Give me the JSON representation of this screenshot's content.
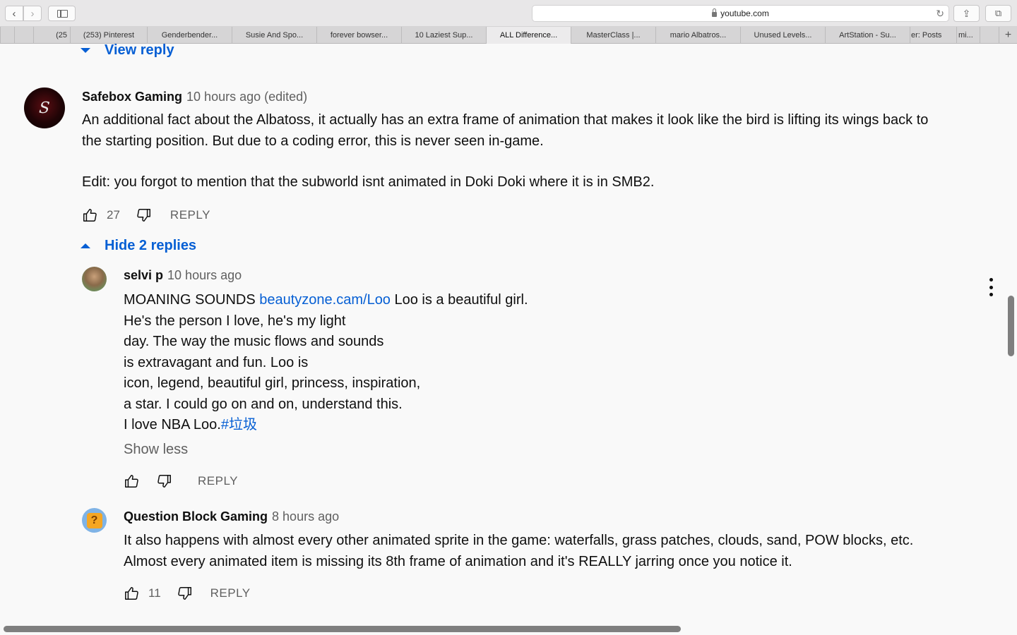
{
  "browser": {
    "address": "youtube.com",
    "tabs": [
      {
        "label": "(25"
      },
      {
        "label": "(253) Pinterest"
      },
      {
        "label": "Genderbender..."
      },
      {
        "label": "Susie And Spo..."
      },
      {
        "label": "forever bowser..."
      },
      {
        "label": "10 Laziest Sup..."
      },
      {
        "label": "ALL Difference..."
      },
      {
        "label": "MasterClass |..."
      },
      {
        "label": "mario Albatros..."
      },
      {
        "label": "Unused Levels..."
      },
      {
        "label": "ArtStation - Su..."
      },
      {
        "label": "er: Posts"
      },
      {
        "label": "mi..."
      }
    ],
    "new_tab": "+"
  },
  "view_reply": "View reply",
  "comment": {
    "author": "Safebox Gaming",
    "time": "10 hours ago (edited)",
    "avatar_letter": "S",
    "line1": "An additional fact about the Albatoss, it actually has an extra frame of animation that makes it look like the bird is lifting its wings back to",
    "line2": "the starting position. But due to a coding error, this is never seen in-game.",
    "line3": "Edit: you forgot to mention that the subworld isnt animated in Doki Doki where it is in SMB2.",
    "likes": "27",
    "reply": "REPLY"
  },
  "hide_replies": "Hide 2 replies",
  "reply1": {
    "author": "selvi p",
    "time": "10 hours ago",
    "line1_a": "MOANING SOUNDS ",
    "line1_link": "beautyzone.cam/Loo",
    "line1_b": " Loo is a beautiful girl.",
    "line2": "He's the person I love, he's my light",
    "line3": "day. The way the music flows and sounds",
    "line4": "is extravagant and fun. Loo is",
    "line5": "icon, legend, beautiful girl, princess, inspiration,",
    "line6": "a star. I could go on and on, understand this.",
    "line7_a": "I love NBA Loo.",
    "line7_tag": "#垃圾",
    "show_less": "Show less",
    "reply": "REPLY"
  },
  "reply2": {
    "author": "Question Block Gaming",
    "time": "8 hours ago",
    "avatar_glyph": "?",
    "line1": "It also happens with almost every other animated sprite in the game: waterfalls, grass patches, clouds, sand, POW blocks, etc.",
    "line2": "Almost every animated item is missing its 8th frame of animation and it's REALLY jarring once you notice it.",
    "likes": "11",
    "reply": "REPLY"
  }
}
